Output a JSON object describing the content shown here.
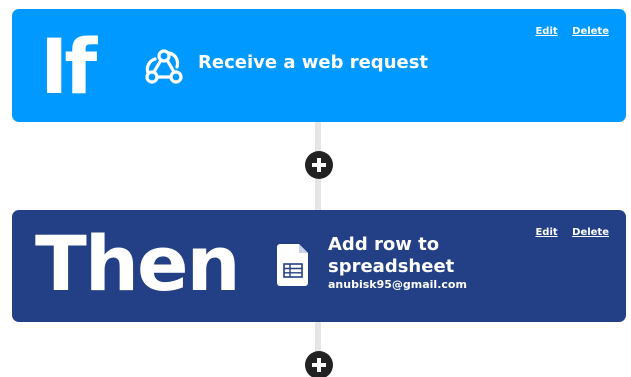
{
  "trigger": {
    "keyword": "If",
    "title": "Receive a web request",
    "icon": "webhook-icon",
    "edit_label": "Edit",
    "delete_label": "Delete",
    "color": "#0099ff"
  },
  "action": {
    "keyword": "Then",
    "title": "Add row to spreadsheet",
    "account": "anubisk95@gmail.com",
    "icon": "google-sheets-icon",
    "edit_label": "Edit",
    "delete_label": "Delete",
    "color": "#233f85"
  },
  "add_step_icon": "plus-icon",
  "connector_color": "#e6e6e6"
}
